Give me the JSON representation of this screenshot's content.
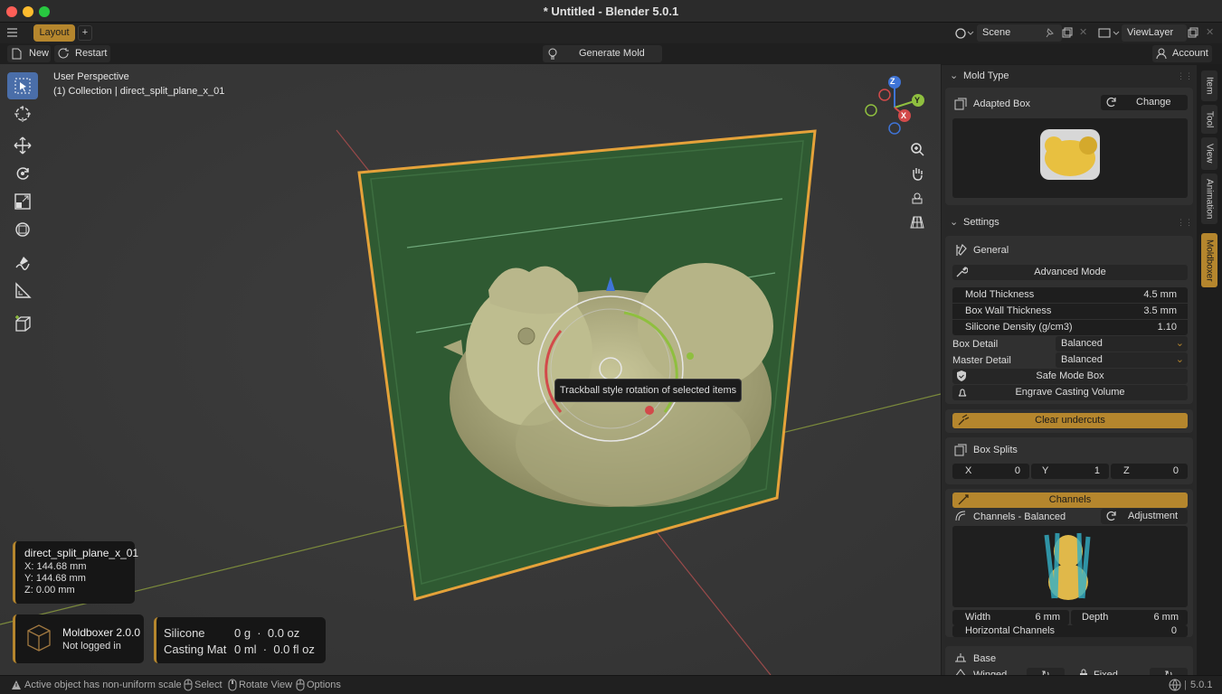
{
  "window": {
    "title": "* Untitled - Blender 5.0.1"
  },
  "menubar": {
    "workspace_tab": "Layout",
    "add_tab": "+",
    "scene": "Scene",
    "view_layer": "ViewLayer"
  },
  "toolheader": {
    "new": "New",
    "restart": "Restart",
    "generate_mold": "Generate Mold",
    "account": "Account"
  },
  "viewport": {
    "perspective": "User Perspective",
    "collection": "(1) Collection | direct_split_plane_x_01",
    "tooltip": "Trackball style rotation of selected items",
    "gizmo": {
      "z": "Z",
      "y": "Y",
      "x": "X"
    }
  },
  "object_info": {
    "name": "direct_split_plane_x_01",
    "x": "X: 144.68 mm",
    "y": "Y: 144.68 mm",
    "z": "Z: 0.00 mm"
  },
  "addon_info": {
    "name": "Moldboxer 2.0.0",
    "status": "Not logged in"
  },
  "materials": {
    "silicone_label": "Silicone",
    "silicone_value": "0 g  ·  0.0 oz",
    "casting_label": "Casting Mat",
    "casting_value": "0 ml  ·  0.0 fl oz"
  },
  "statusbar": {
    "warning": "Active object has non-uniform scale",
    "select": "Select",
    "rotate": "Rotate View",
    "options": "Options",
    "version": "5.0.1"
  },
  "side_tabs": [
    "Item",
    "Tool",
    "View",
    "Animation",
    "Moldboxer"
  ],
  "panel": {
    "mold_type": {
      "header": "Mold Type",
      "type": "Adapted Box",
      "change": "Change"
    },
    "settings": {
      "header": "Settings",
      "general": "General",
      "advanced_mode": "Advanced Mode",
      "mold_thickness_label": "Mold Thickness",
      "mold_thickness": "4.5 mm",
      "box_wall_label": "Box Wall Thickness",
      "box_wall": "3.5 mm",
      "silicone_density_label": "Silicone Density (g/cm3)",
      "silicone_density": "1.10",
      "box_detail_label": "Box Detail",
      "box_detail": "Balanced",
      "master_detail_label": "Master Detail",
      "master_detail": "Balanced",
      "safe_mode": "Safe Mode Box",
      "engrave": "Engrave Casting Volume"
    },
    "clear_undercuts": "Clear undercuts",
    "box_splits": {
      "header": "Box Splits",
      "x_label": "X",
      "x": "0",
      "y_label": "Y",
      "y": "1",
      "z_label": "Z",
      "z": "0"
    },
    "channels": {
      "header": "Channels",
      "preset": "Channels - Balanced",
      "adjustment": "Adjustment",
      "width_label": "Width",
      "width": "6 mm",
      "depth_label": "Depth",
      "depth": "6 mm",
      "horizontal_label": "Horizontal Channels",
      "horizontal": "0"
    },
    "base": {
      "header": "Base",
      "winged": "Winged",
      "fixed": "Fixed"
    }
  },
  "colors": {
    "accent": "#b5862d",
    "plane": "#2f5a32"
  }
}
